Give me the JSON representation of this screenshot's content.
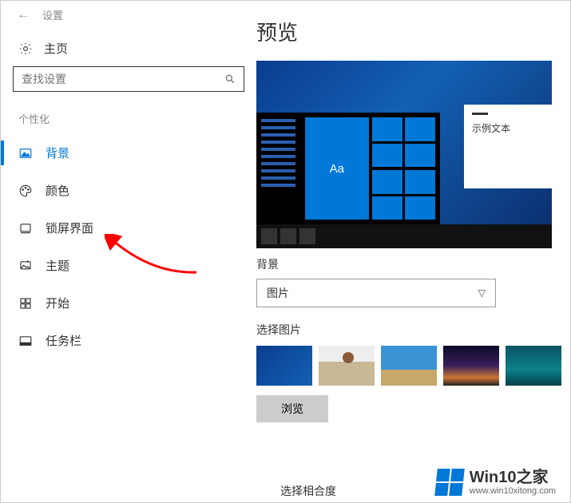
{
  "titlebar": {
    "app_title": "设置"
  },
  "home_label": "主页",
  "search": {
    "placeholder": "查找设置"
  },
  "category_label": "个性化",
  "nav": [
    {
      "label": "背景"
    },
    {
      "label": "颜色"
    },
    {
      "label": "锁屏界面"
    },
    {
      "label": "主题"
    },
    {
      "label": "开始"
    },
    {
      "label": "任务栏"
    }
  ],
  "main": {
    "preview_heading": "预览",
    "sample_text_label": "示例文本",
    "tile_label": "Aa",
    "background_label": "背景",
    "background_dropdown_value": "图片",
    "choose_picture_label": "选择图片",
    "browse_button": "浏览",
    "truncated_label": "选择相合度"
  },
  "watermark": {
    "main": "Win10之家",
    "sub": "www.win10xitong.com"
  }
}
